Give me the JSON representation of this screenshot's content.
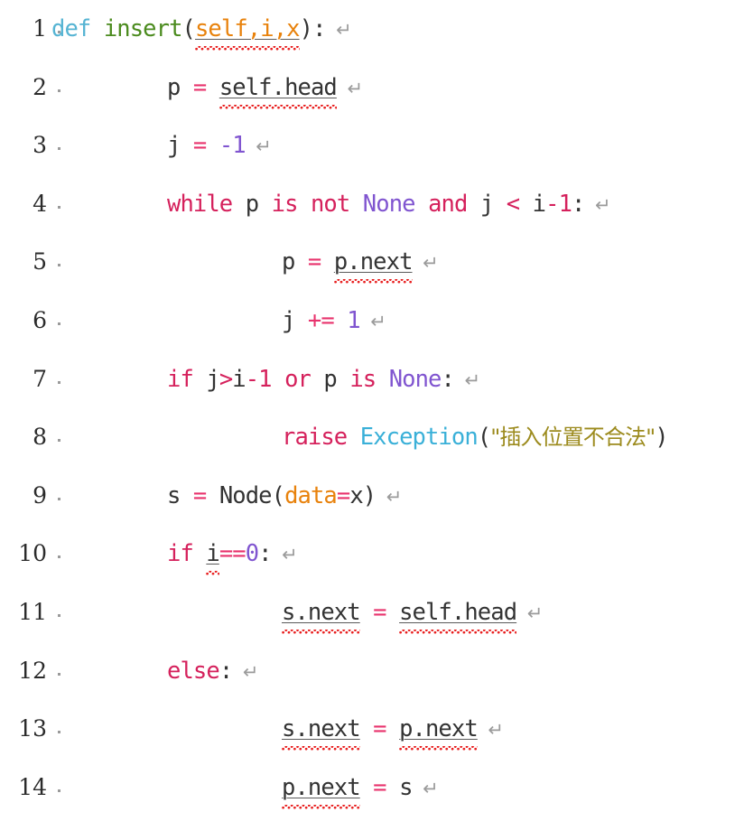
{
  "editor": {
    "language": "Python",
    "line_count": 14,
    "cr_glyph": "↵",
    "indent_dot_glyph": "·",
    "colors": {
      "background": "#ffffff",
      "line_number": "#2b2b2b",
      "plain_text": "#333333",
      "keyword": "#d5215c",
      "def_keyword": "#56b4d3",
      "function_name": "#4b8b1e",
      "parameter": "#e8820c",
      "constant": "#8055d0",
      "operator": "#e8336d",
      "class_name": "#3ab0d8",
      "string": "#9c8b1e",
      "spellcheck_squiggle": "#e81f1f",
      "cr_mark": "#9b9b9b"
    }
  },
  "lines": [
    {
      "number": "1",
      "indent": 0,
      "has_indent_dot": true,
      "text": "def insert(self,i,x):",
      "tokens": [
        {
          "t": "def",
          "c": "t-def"
        },
        {
          "t": " ",
          "c": "t-plain"
        },
        {
          "t": "insert",
          "c": "t-fname"
        },
        {
          "t": "(",
          "c": "t-punct"
        },
        {
          "t": "self,i,x",
          "c": "t-param",
          "squiggle": true
        },
        {
          "t": ")",
          "c": "t-punct"
        },
        {
          "t": ":",
          "c": "t-punct"
        }
      ]
    },
    {
      "number": "2",
      "indent": 1,
      "has_indent_dot": true,
      "text": "p = self.head",
      "tokens": [
        {
          "t": "p",
          "c": "t-plain"
        },
        {
          "t": " ",
          "c": "t-plain"
        },
        {
          "t": "=",
          "c": "t-op"
        },
        {
          "t": " ",
          "c": "t-plain"
        },
        {
          "t": "self.head",
          "c": "t-plain",
          "squiggle": true
        }
      ]
    },
    {
      "number": "3",
      "indent": 1,
      "has_indent_dot": true,
      "text": "j = -1",
      "tokens": [
        {
          "t": "j",
          "c": "t-plain"
        },
        {
          "t": " ",
          "c": "t-plain"
        },
        {
          "t": "=",
          "c": "t-op"
        },
        {
          "t": " ",
          "c": "t-plain"
        },
        {
          "t": "-1",
          "c": "t-num"
        }
      ]
    },
    {
      "number": "4",
      "indent": 1,
      "has_indent_dot": true,
      "text": "while p is not None and j < i-1:",
      "tokens": [
        {
          "t": "while",
          "c": "t-kw"
        },
        {
          "t": " p ",
          "c": "t-plain"
        },
        {
          "t": "is",
          "c": "t-kw"
        },
        {
          "t": " ",
          "c": "t-plain"
        },
        {
          "t": "not",
          "c": "t-kw"
        },
        {
          "t": " ",
          "c": "t-plain"
        },
        {
          "t": "None",
          "c": "t-const"
        },
        {
          "t": " ",
          "c": "t-plain"
        },
        {
          "t": "and",
          "c": "t-kw"
        },
        {
          "t": " j ",
          "c": "t-plain"
        },
        {
          "t": "<",
          "c": "t-opk"
        },
        {
          "t": " i",
          "c": "t-plain"
        },
        {
          "t": "-1",
          "c": "t-opk"
        },
        {
          "t": ":",
          "c": "t-punct"
        }
      ]
    },
    {
      "number": "5",
      "indent": 2,
      "has_indent_dot": true,
      "text": "p = p.next",
      "tokens": [
        {
          "t": "p",
          "c": "t-plain"
        },
        {
          "t": " ",
          "c": "t-plain"
        },
        {
          "t": "=",
          "c": "t-op"
        },
        {
          "t": " ",
          "c": "t-plain"
        },
        {
          "t": "p.next",
          "c": "t-plain",
          "squiggle": true
        }
      ]
    },
    {
      "number": "6",
      "indent": 2,
      "has_indent_dot": true,
      "text": "j += 1",
      "tokens": [
        {
          "t": "j",
          "c": "t-plain"
        },
        {
          "t": " ",
          "c": "t-plain"
        },
        {
          "t": "+=",
          "c": "t-op"
        },
        {
          "t": " ",
          "c": "t-plain"
        },
        {
          "t": "1",
          "c": "t-num"
        }
      ]
    },
    {
      "number": "7",
      "indent": 1,
      "has_indent_dot": true,
      "text": "if j>i-1 or p is None:",
      "tokens": [
        {
          "t": "if",
          "c": "t-kw"
        },
        {
          "t": " j",
          "c": "t-plain"
        },
        {
          "t": ">",
          "c": "t-opk"
        },
        {
          "t": "i",
          "c": "t-plain"
        },
        {
          "t": "-1",
          "c": "t-opk"
        },
        {
          "t": " ",
          "c": "t-plain"
        },
        {
          "t": "or",
          "c": "t-kw"
        },
        {
          "t": " p ",
          "c": "t-plain"
        },
        {
          "t": "is",
          "c": "t-kw"
        },
        {
          "t": " ",
          "c": "t-plain"
        },
        {
          "t": "None",
          "c": "t-const"
        },
        {
          "t": ":",
          "c": "t-punct"
        }
      ]
    },
    {
      "number": "8",
      "indent": 2,
      "has_indent_dot": true,
      "no_cr": true,
      "text": "raise Exception(\"插入位置不合法\")",
      "tokens": [
        {
          "t": "raise",
          "c": "t-kw"
        },
        {
          "t": " ",
          "c": "t-plain"
        },
        {
          "t": "Exception",
          "c": "t-cls"
        },
        {
          "t": "(",
          "c": "t-punct"
        },
        {
          "t": "\"插入位置不合法\"",
          "c": "t-str",
          "cjk": true
        },
        {
          "t": ")",
          "c": "t-punct"
        }
      ]
    },
    {
      "number": "9",
      "indent": 1,
      "has_indent_dot": true,
      "text": "s = Node(data=x)",
      "tokens": [
        {
          "t": "s",
          "c": "t-plain"
        },
        {
          "t": " ",
          "c": "t-plain"
        },
        {
          "t": "=",
          "c": "t-op"
        },
        {
          "t": " ",
          "c": "t-plain"
        },
        {
          "t": "Node",
          "c": "t-plain"
        },
        {
          "t": "(",
          "c": "t-punct"
        },
        {
          "t": "data",
          "c": "t-param"
        },
        {
          "t": "=",
          "c": "t-op"
        },
        {
          "t": "x",
          "c": "t-plain"
        },
        {
          "t": ")",
          "c": "t-punct"
        }
      ]
    },
    {
      "number": "10",
      "indent": 1,
      "has_indent_dot": true,
      "text": "if i==0:",
      "tokens": [
        {
          "t": "if",
          "c": "t-kw"
        },
        {
          "t": " ",
          "c": "t-plain"
        },
        {
          "t": "i",
          "c": "t-plain",
          "squiggle": true
        },
        {
          "t": "==",
          "c": "t-op"
        },
        {
          "t": "0",
          "c": "t-num"
        },
        {
          "t": ":",
          "c": "t-punct"
        }
      ]
    },
    {
      "number": "11",
      "indent": 2,
      "has_indent_dot": true,
      "text": "s.next = self.head",
      "tokens": [
        {
          "t": "s.next",
          "c": "t-plain",
          "squiggle": true
        },
        {
          "t": " ",
          "c": "t-plain"
        },
        {
          "t": "=",
          "c": "t-op"
        },
        {
          "t": " ",
          "c": "t-plain"
        },
        {
          "t": "self.head",
          "c": "t-plain",
          "squiggle": true
        }
      ]
    },
    {
      "number": "12",
      "indent": 1,
      "has_indent_dot": true,
      "text": "else:",
      "tokens": [
        {
          "t": "else",
          "c": "t-kw"
        },
        {
          "t": ":",
          "c": "t-punct"
        }
      ]
    },
    {
      "number": "13",
      "indent": 2,
      "has_indent_dot": true,
      "text": "s.next = p.next",
      "tokens": [
        {
          "t": "s.next",
          "c": "t-plain",
          "squiggle": true
        },
        {
          "t": " ",
          "c": "t-plain"
        },
        {
          "t": "=",
          "c": "t-op"
        },
        {
          "t": " ",
          "c": "t-plain"
        },
        {
          "t": "p.next",
          "c": "t-plain",
          "squiggle": true
        }
      ]
    },
    {
      "number": "14",
      "indent": 2,
      "has_indent_dot": true,
      "text": "p.next = s",
      "tokens": [
        {
          "t": "p.next",
          "c": "t-plain",
          "squiggle": true
        },
        {
          "t": " ",
          "c": "t-plain"
        },
        {
          "t": "=",
          "c": "t-op"
        },
        {
          "t": " ",
          "c": "t-plain"
        },
        {
          "t": "s",
          "c": "t-plain"
        }
      ]
    }
  ]
}
